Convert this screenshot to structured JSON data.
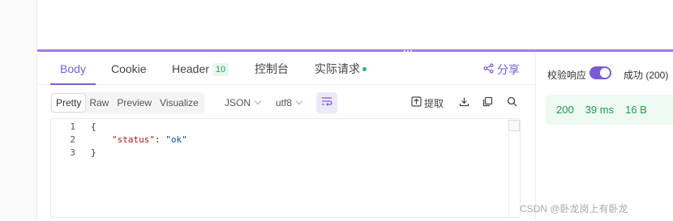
{
  "tabs": [
    {
      "label": "Body",
      "active": true
    },
    {
      "label": "Cookie"
    },
    {
      "label": "Header",
      "badge": "10"
    },
    {
      "label": "控制台"
    },
    {
      "label": "实际请求",
      "indicator": "green-dot"
    }
  ],
  "share_label": "分享",
  "toolbar": {
    "view_modes": [
      "Pretty",
      "Raw",
      "Preview",
      "Visualize"
    ],
    "selected_view": "Pretty",
    "format": "JSON",
    "encoding": "utf8",
    "extract_label": "提取",
    "icons": [
      "wrap-lines-icon",
      "extract-icon",
      "download-icon",
      "copy-icon",
      "search-icon"
    ]
  },
  "editor": {
    "lines": [
      {
        "n": "1",
        "text": "{"
      },
      {
        "n": "2",
        "key": "\"status\"",
        "sep": ": ",
        "value": "\"ok\""
      },
      {
        "n": "3",
        "text": "}"
      }
    ]
  },
  "right_panel": {
    "validate_label": "校验响应",
    "validate_on": true,
    "status_text": "成功 (200)",
    "stats": {
      "code": "200",
      "time": "39 ms",
      "size": "16 B"
    }
  },
  "watermark": "CSDN @卧龙岗上有卧龙",
  "colors": {
    "accent": "#7b5cd6",
    "success": "#1e9a52",
    "success_bg": "#eef9f2"
  }
}
